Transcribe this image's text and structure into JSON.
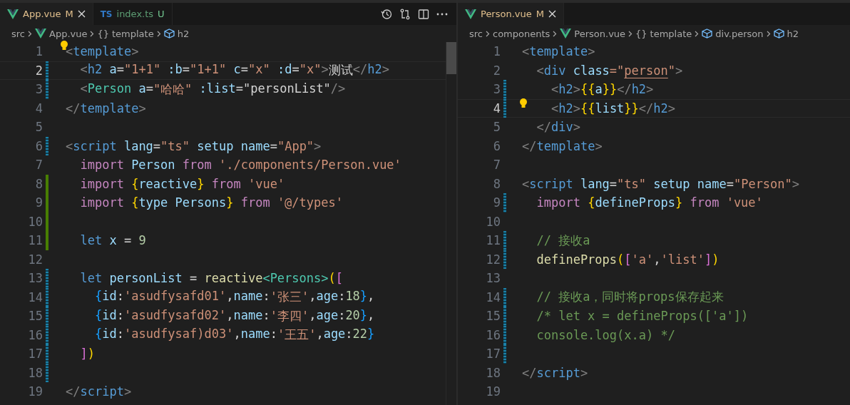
{
  "panes": [
    {
      "tabs": [
        {
          "label": "App.vue",
          "kind": "vue",
          "status": "M",
          "color": "#e2c08d",
          "selected": true
        },
        {
          "label": "index.ts",
          "kind": "typescript",
          "badge": "TS",
          "status": "U",
          "color": "#73c991",
          "selected": false
        }
      ],
      "toolbar": [
        {
          "kind": "history"
        },
        {
          "kind": "compare"
        },
        {
          "kind": "split"
        },
        {
          "kind": "more"
        }
      ],
      "breadcrumbs": [
        {
          "label": "src",
          "kind": "folder"
        },
        {
          "label": "App.vue",
          "kind": "vue"
        },
        {
          "prefix": "{}",
          "label": "template",
          "kind": "symbol"
        },
        {
          "label": "h2",
          "kind": "element"
        }
      ],
      "lines": [
        {
          "n": "1",
          "lightbulb": true,
          "tokens": [
            {
              "text": "<",
              "kind": "punct"
            },
            {
              "text": "template",
              "kind": "tag"
            },
            {
              "text": ">",
              "kind": "punct"
            }
          ]
        },
        {
          "n": "2",
          "kind": "modified",
          "current": true,
          "tokens": [
            {
              "text": "  <",
              "kind": "punct"
            },
            {
              "text": "h2",
              "kind": "tag"
            },
            {
              "text": " a",
              "kind": "attr"
            },
            {
              "text": "=",
              "kind": "plain"
            },
            {
              "text": "\"1+1\"",
              "kind": "str"
            },
            {
              "text": " :b",
              "kind": "attr"
            },
            {
              "text": "=",
              "kind": "plain"
            },
            {
              "text": "\"1+1\"",
              "kind": "str"
            },
            {
              "text": " c",
              "kind": "attr"
            },
            {
              "text": "=",
              "kind": "plain"
            },
            {
              "text": "\"x\"",
              "kind": "str"
            },
            {
              "text": " :d",
              "kind": "attr"
            },
            {
              "text": "=",
              "kind": "plain"
            },
            {
              "text": "\"x\"",
              "kind": "str"
            },
            {
              "text": ">",
              "kind": "punct"
            },
            {
              "text": "测试",
              "kind": "plain"
            },
            {
              "text": "</",
              "kind": "punct"
            },
            {
              "text": "h2",
              "kind": "tag"
            },
            {
              "text": ">",
              "kind": "punct"
            }
          ]
        },
        {
          "n": "3",
          "kind": "modified",
          "tokens": [
            {
              "text": "  <",
              "kind": "punct"
            },
            {
              "text": "Person",
              "kind": "type"
            },
            {
              "text": " a",
              "kind": "attr"
            },
            {
              "text": "=",
              "kind": "plain"
            },
            {
              "text": "\"哈哈\"",
              "kind": "str"
            },
            {
              "text": " :list",
              "kind": "attr"
            },
            {
              "text": "=",
              "kind": "plain"
            },
            {
              "text": "\"personList\"",
              "kind": "plain"
            },
            {
              "text": "/>",
              "kind": "punct"
            }
          ]
        },
        {
          "n": "4",
          "tokens": [
            {
              "text": "</",
              "kind": "punct"
            },
            {
              "text": "template",
              "kind": "tag"
            },
            {
              "text": ">",
              "kind": "punct"
            }
          ]
        },
        {
          "n": "5"
        },
        {
          "n": "6",
          "kind": "modified",
          "tokens": [
            {
              "text": "<",
              "kind": "punct"
            },
            {
              "text": "script",
              "kind": "tag"
            },
            {
              "text": " lang",
              "kind": "attr"
            },
            {
              "text": "=",
              "kind": "plain"
            },
            {
              "text": "\"ts\"",
              "kind": "str"
            },
            {
              "text": " setup",
              "kind": "attr"
            },
            {
              "text": " name",
              "kind": "attr"
            },
            {
              "text": "=",
              "kind": "plain"
            },
            {
              "text": "\"App\"",
              "kind": "str"
            },
            {
              "text": ">",
              "kind": "punct"
            }
          ]
        },
        {
          "n": "7",
          "tokens": [
            {
              "text": "  import",
              "kind": "keyword"
            },
            {
              "text": " Person",
              "kind": "var"
            },
            {
              "text": " from",
              "kind": "keyword"
            },
            {
              "text": " './components/Person.vue'",
              "kind": "str"
            }
          ]
        },
        {
          "n": "8",
          "kind": "added",
          "tokens": [
            {
              "text": "  import",
              "kind": "keyword"
            },
            {
              "text": " {",
              "kind": "bracket1"
            },
            {
              "text": "reactive",
              "kind": "var"
            },
            {
              "text": "}",
              "kind": "bracket1"
            },
            {
              "text": " from",
              "kind": "keyword"
            },
            {
              "text": " 'vue'",
              "kind": "str"
            }
          ]
        },
        {
          "n": "9",
          "kind": "added",
          "tokens": [
            {
              "text": "  import",
              "kind": "keyword"
            },
            {
              "text": " {",
              "kind": "bracket1"
            },
            {
              "text": "type Persons",
              "kind": "var"
            },
            {
              "text": "}",
              "kind": "bracket1"
            },
            {
              "text": " from",
              "kind": "keyword"
            },
            {
              "text": " '@/types'",
              "kind": "str"
            }
          ]
        },
        {
          "n": "10",
          "kind": "added"
        },
        {
          "n": "11",
          "kind": "added",
          "tokens": [
            {
              "text": "  let",
              "kind": "storage"
            },
            {
              "text": " x",
              "kind": "var"
            },
            {
              "text": " =",
              "kind": "plain"
            },
            {
              "text": " 9",
              "kind": "num"
            }
          ]
        },
        {
          "n": "12"
        },
        {
          "n": "13",
          "kind": "modified",
          "tokens": [
            {
              "text": "  let",
              "kind": "storage"
            },
            {
              "text": " personList",
              "kind": "var"
            },
            {
              "text": " =",
              "kind": "plain"
            },
            {
              "text": " reactive",
              "kind": "func"
            },
            {
              "text": "<Persons>",
              "kind": "type"
            },
            {
              "text": "(",
              "kind": "bracket1"
            },
            {
              "text": "[",
              "kind": "bracket2"
            }
          ]
        },
        {
          "n": "14",
          "kind": "modified",
          "tokens": [
            {
              "text": "    {",
              "kind": "bracket3"
            },
            {
              "text": "id",
              "kind": "var"
            },
            {
              "text": ":",
              "kind": "plain"
            },
            {
              "text": "'asudfysafd01'",
              "kind": "str"
            },
            {
              "text": ",",
              "kind": "plain"
            },
            {
              "text": "name",
              "kind": "var"
            },
            {
              "text": ":",
              "kind": "plain"
            },
            {
              "text": "'张三'",
              "kind": "str"
            },
            {
              "text": ",",
              "kind": "plain"
            },
            {
              "text": "age",
              "kind": "var"
            },
            {
              "text": ":",
              "kind": "plain"
            },
            {
              "text": "18",
              "kind": "num"
            },
            {
              "text": "}",
              "kind": "bracket3"
            },
            {
              "text": ",",
              "kind": "plain"
            }
          ]
        },
        {
          "n": "15",
          "kind": "modified",
          "tokens": [
            {
              "text": "    {",
              "kind": "bracket3"
            },
            {
              "text": "id",
              "kind": "var"
            },
            {
              "text": ":",
              "kind": "plain"
            },
            {
              "text": "'asudfysafd02'",
              "kind": "str"
            },
            {
              "text": ",",
              "kind": "plain"
            },
            {
              "text": "name",
              "kind": "var"
            },
            {
              "text": ":",
              "kind": "plain"
            },
            {
              "text": "'李四'",
              "kind": "str"
            },
            {
              "text": ",",
              "kind": "plain"
            },
            {
              "text": "age",
              "kind": "var"
            },
            {
              "text": ":",
              "kind": "plain"
            },
            {
              "text": "20",
              "kind": "num"
            },
            {
              "text": "}",
              "kind": "bracket3"
            },
            {
              "text": ",",
              "kind": "plain"
            }
          ]
        },
        {
          "n": "16",
          "kind": "modified",
          "tokens": [
            {
              "text": "    {",
              "kind": "bracket3"
            },
            {
              "text": "id",
              "kind": "var"
            },
            {
              "text": ":",
              "kind": "plain"
            },
            {
              "text": "'asudfysaf)d03'",
              "kind": "str"
            },
            {
              "text": ",",
              "kind": "plain"
            },
            {
              "text": "name",
              "kind": "var"
            },
            {
              "text": ":",
              "kind": "plain"
            },
            {
              "text": "'王五'",
              "kind": "str"
            },
            {
              "text": ",",
              "kind": "plain"
            },
            {
              "text": "age",
              "kind": "var"
            },
            {
              "text": ":",
              "kind": "plain"
            },
            {
              "text": "22",
              "kind": "num"
            },
            {
              "text": "}",
              "kind": "bracket3"
            }
          ]
        },
        {
          "n": "17",
          "kind": "modified",
          "tokens": [
            {
              "text": "  ]",
              "kind": "bracket2"
            },
            {
              "text": ")",
              "kind": "bracket1"
            }
          ]
        },
        {
          "n": "18",
          "kind": "modified"
        },
        {
          "n": "19",
          "tokens": [
            {
              "text": "</",
              "kind": "punct"
            },
            {
              "text": "script",
              "kind": "tag"
            },
            {
              "text": ">",
              "kind": "punct"
            }
          ]
        }
      ]
    },
    {
      "tabs": [
        {
          "label": "Person.vue",
          "kind": "vue",
          "status": "M",
          "color": "#e2c08d",
          "selected": true
        }
      ],
      "breadcrumbs": [
        {
          "label": "src",
          "kind": "folder"
        },
        {
          "label": "components",
          "kind": "folder"
        },
        {
          "label": "Person.vue",
          "kind": "vue"
        },
        {
          "prefix": "{}",
          "label": "template",
          "kind": "symbol"
        },
        {
          "label": "div.person",
          "kind": "element"
        },
        {
          "label": "h2",
          "kind": "element"
        }
      ],
      "lines": [
        {
          "n": "1",
          "tokens": [
            {
              "text": "<",
              "kind": "punct"
            },
            {
              "text": "template",
              "kind": "tag"
            },
            {
              "text": ">",
              "kind": "punct"
            }
          ]
        },
        {
          "n": "2",
          "tokens": [
            {
              "text": "  <",
              "kind": "punct"
            },
            {
              "text": "div",
              "kind": "tag"
            },
            {
              "text": " class",
              "kind": "attr"
            },
            {
              "text": "=\"",
              "kind": "str"
            },
            {
              "text": "person",
              "kind": "link"
            },
            {
              "text": "\"",
              "kind": "str"
            },
            {
              "text": ">",
              "kind": "punct"
            }
          ]
        },
        {
          "n": "3",
          "kind": "modified",
          "tokens": [
            {
              "text": "    <",
              "kind": "punct"
            },
            {
              "text": "h2",
              "kind": "tag"
            },
            {
              "text": ">",
              "kind": "punct"
            },
            {
              "text": "{{",
              "kind": "bracket1"
            },
            {
              "text": "a",
              "kind": "var"
            },
            {
              "text": "}}",
              "kind": "bracket1"
            },
            {
              "text": "</",
              "kind": "punct"
            },
            {
              "text": "h2",
              "kind": "tag"
            },
            {
              "text": ">",
              "kind": "punct"
            }
          ]
        },
        {
          "n": "4",
          "kind": "modified",
          "current": true,
          "lightbulb": true,
          "tokens": [
            {
              "text": "    <",
              "kind": "punct"
            },
            {
              "text": "h2",
              "kind": "tag"
            },
            {
              "text": ">",
              "kind": "punct"
            },
            {
              "text": "{{",
              "kind": "bracket1"
            },
            {
              "text": "list",
              "kind": "var"
            },
            {
              "text": "}}",
              "kind": "bracket1"
            },
            {
              "text": "</",
              "kind": "punct"
            },
            {
              "text": "h2",
              "kind": "tag"
            },
            {
              "text": ">",
              "kind": "punct"
            }
          ]
        },
        {
          "n": "5",
          "tokens": [
            {
              "text": "  </",
              "kind": "punct"
            },
            {
              "text": "div",
              "kind": "tag"
            },
            {
              "text": ">",
              "kind": "punct"
            }
          ]
        },
        {
          "n": "6",
          "tokens": [
            {
              "text": "</",
              "kind": "punct"
            },
            {
              "text": "template",
              "kind": "tag"
            },
            {
              "text": ">",
              "kind": "punct"
            }
          ]
        },
        {
          "n": "7"
        },
        {
          "n": "8",
          "tokens": [
            {
              "text": "<",
              "kind": "punct"
            },
            {
              "text": "script",
              "kind": "tag"
            },
            {
              "text": " lang",
              "kind": "attr"
            },
            {
              "text": "=",
              "kind": "plain"
            },
            {
              "text": "\"ts\"",
              "kind": "str"
            },
            {
              "text": " setup",
              "kind": "attr"
            },
            {
              "text": " name",
              "kind": "attr"
            },
            {
              "text": "=",
              "kind": "plain"
            },
            {
              "text": "\"Person\"",
              "kind": "str"
            },
            {
              "text": ">",
              "kind": "punct"
            }
          ]
        },
        {
          "n": "9",
          "kind": "modified",
          "tokens": [
            {
              "text": "  import",
              "kind": "keyword"
            },
            {
              "text": " {",
              "kind": "bracket1"
            },
            {
              "text": "defineProps",
              "kind": "var"
            },
            {
              "text": "}",
              "kind": "bracket1"
            },
            {
              "text": " from",
              "kind": "keyword"
            },
            {
              "text": " 'vue'",
              "kind": "str"
            }
          ]
        },
        {
          "n": "10"
        },
        {
          "n": "11",
          "kind": "modified",
          "tokens": [
            {
              "text": "  // 接收a",
              "kind": "comment"
            }
          ]
        },
        {
          "n": "12",
          "kind": "modified",
          "tokens": [
            {
              "text": "  defineProps",
              "kind": "func"
            },
            {
              "text": "(",
              "kind": "bracket1"
            },
            {
              "text": "[",
              "kind": "bracket2"
            },
            {
              "text": "'a'",
              "kind": "str"
            },
            {
              "text": ",",
              "kind": "plain"
            },
            {
              "text": "'list'",
              "kind": "str"
            },
            {
              "text": "]",
              "kind": "bracket2"
            },
            {
              "text": ")",
              "kind": "bracket1"
            }
          ]
        },
        {
          "n": "13"
        },
        {
          "n": "14",
          "kind": "modified",
          "tokens": [
            {
              "text": "  // 接收a，同时将props保存起来",
              "kind": "comment"
            }
          ]
        },
        {
          "n": "15",
          "kind": "modified",
          "tokens": [
            {
              "text": "  /* let x = defineProps(['a'])",
              "kind": "comment"
            }
          ]
        },
        {
          "n": "16",
          "kind": "modified",
          "tokens": [
            {
              "text": "  console.log(x.a) */",
              "kind": "comment"
            }
          ]
        },
        {
          "n": "17",
          "kind": "modified"
        },
        {
          "n": "18",
          "tokens": [
            {
              "text": "</",
              "kind": "punct"
            },
            {
              "text": "script",
              "kind": "tag"
            },
            {
              "text": ">",
              "kind": "punct"
            }
          ]
        },
        {
          "n": "19"
        }
      ]
    }
  ]
}
